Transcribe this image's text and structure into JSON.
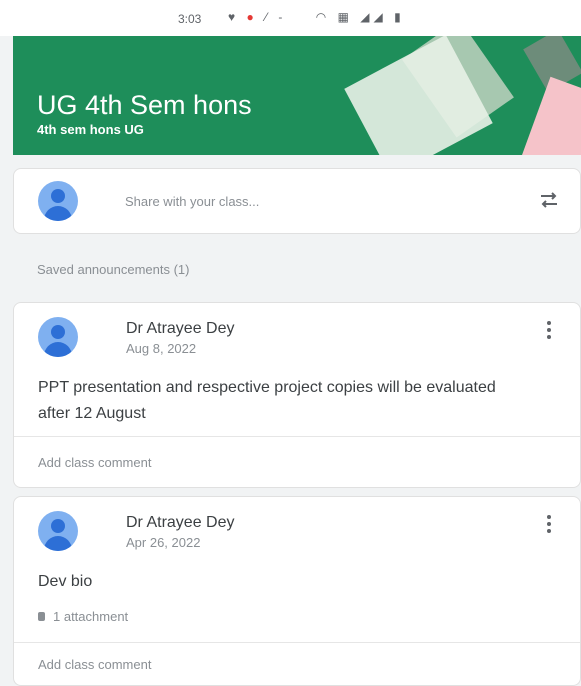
{
  "status_bar": {
    "time": "3:03",
    "icons": [
      "notification-icon",
      "dnd-icon",
      "mute-icon",
      "dash-icon",
      "wifi-icon",
      "network-icon",
      "signal-icon",
      "battery-icon"
    ]
  },
  "class": {
    "title": "UG 4th Sem hons",
    "subtitle": "4th sem hons UG",
    "banner_color": "#1e8e5a"
  },
  "share": {
    "placeholder": "Share with your class..."
  },
  "saved_announcements": {
    "label": "Saved announcements (1)"
  },
  "posts": [
    {
      "author": "Dr Atrayee Dey",
      "date": "Aug 8, 2022",
      "text": "PPT presentation and respective project copies will be evaluated after 12 August",
      "comment_label": "Add class comment"
    },
    {
      "author": "Dr Atrayee Dey",
      "date": "Apr 26, 2022",
      "text": "Dev bio",
      "attachment": "1 attachment",
      "comment_label": "Add class comment"
    }
  ]
}
